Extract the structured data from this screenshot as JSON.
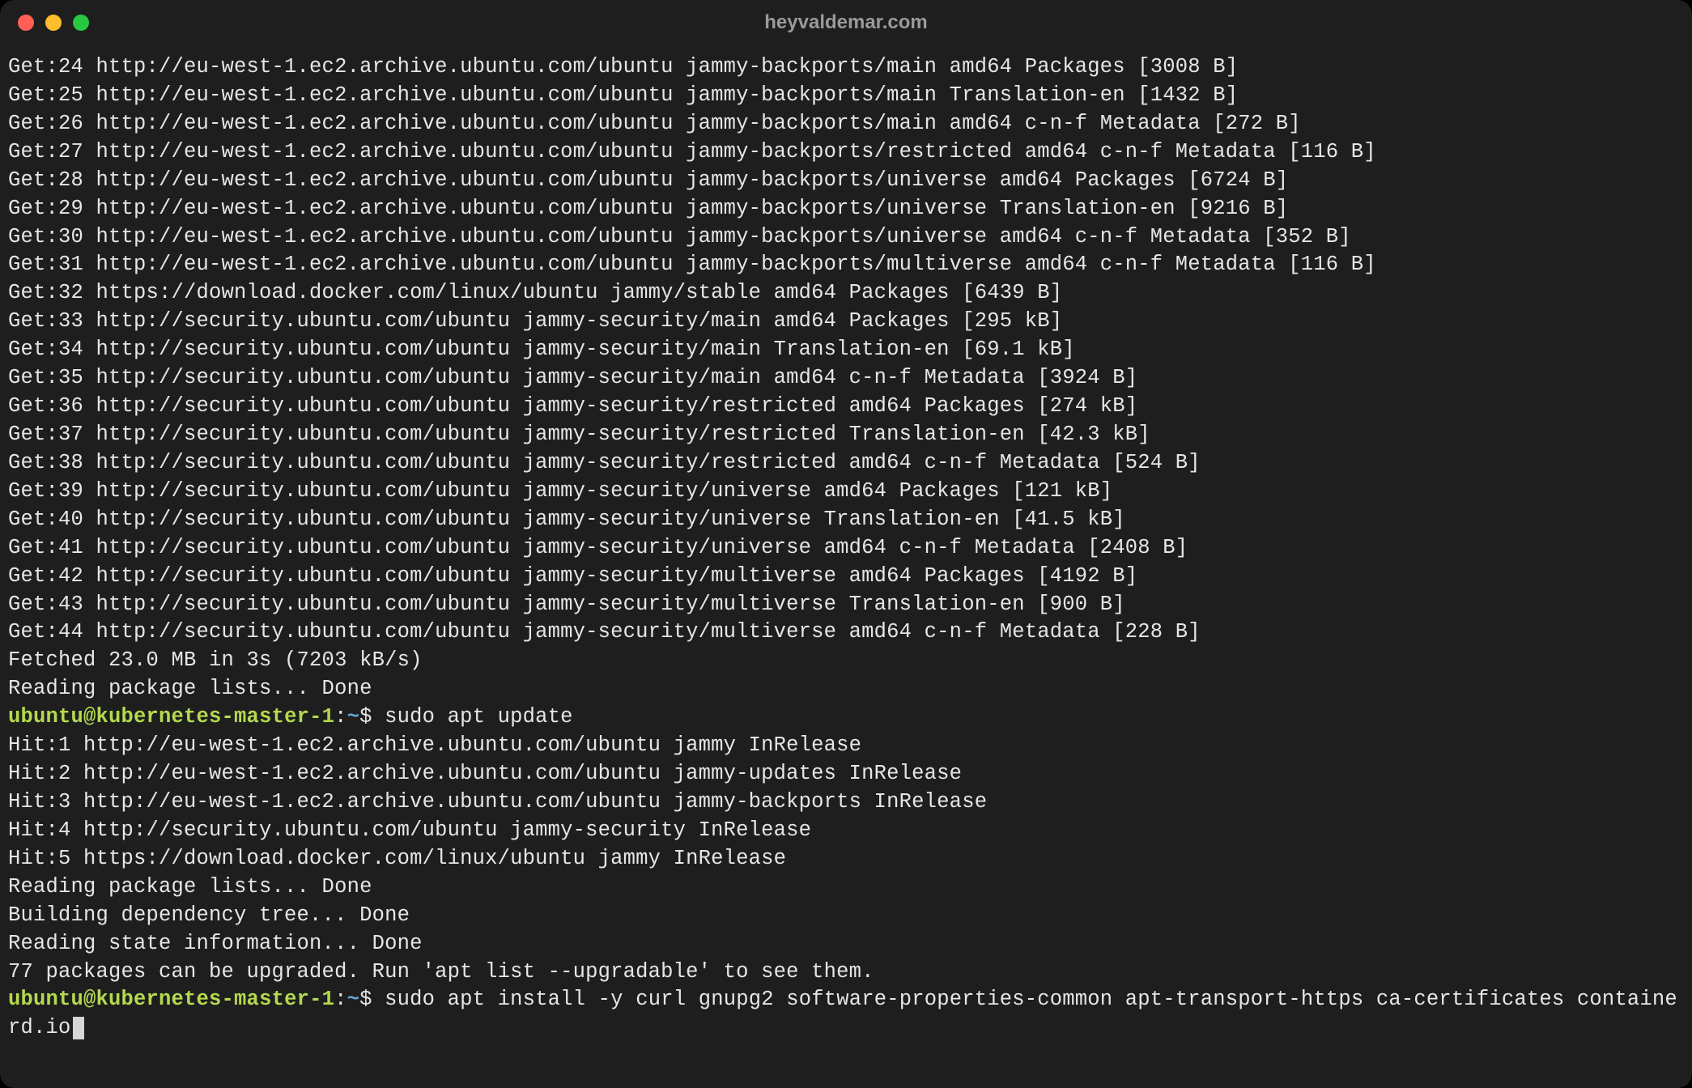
{
  "window": {
    "title": "heyvaldemar.com"
  },
  "prompt": {
    "user": "ubuntu",
    "at": "@",
    "host": "kubernetes-master-1",
    "colon": ":",
    "path": "~",
    "sigil": "$ "
  },
  "output_before": [
    "Get:24 http://eu-west-1.ec2.archive.ubuntu.com/ubuntu jammy-backports/main amd64 Packages [3008 B]",
    "Get:25 http://eu-west-1.ec2.archive.ubuntu.com/ubuntu jammy-backports/main Translation-en [1432 B]",
    "Get:26 http://eu-west-1.ec2.archive.ubuntu.com/ubuntu jammy-backports/main amd64 c-n-f Metadata [272 B]",
    "Get:27 http://eu-west-1.ec2.archive.ubuntu.com/ubuntu jammy-backports/restricted amd64 c-n-f Metadata [116 B]",
    "Get:28 http://eu-west-1.ec2.archive.ubuntu.com/ubuntu jammy-backports/universe amd64 Packages [6724 B]",
    "Get:29 http://eu-west-1.ec2.archive.ubuntu.com/ubuntu jammy-backports/universe Translation-en [9216 B]",
    "Get:30 http://eu-west-1.ec2.archive.ubuntu.com/ubuntu jammy-backports/universe amd64 c-n-f Metadata [352 B]",
    "Get:31 http://eu-west-1.ec2.archive.ubuntu.com/ubuntu jammy-backports/multiverse amd64 c-n-f Metadata [116 B]",
    "Get:32 https://download.docker.com/linux/ubuntu jammy/stable amd64 Packages [6439 B]",
    "Get:33 http://security.ubuntu.com/ubuntu jammy-security/main amd64 Packages [295 kB]",
    "Get:34 http://security.ubuntu.com/ubuntu jammy-security/main Translation-en [69.1 kB]",
    "Get:35 http://security.ubuntu.com/ubuntu jammy-security/main amd64 c-n-f Metadata [3924 B]",
    "Get:36 http://security.ubuntu.com/ubuntu jammy-security/restricted amd64 Packages [274 kB]",
    "Get:37 http://security.ubuntu.com/ubuntu jammy-security/restricted Translation-en [42.3 kB]",
    "Get:38 http://security.ubuntu.com/ubuntu jammy-security/restricted amd64 c-n-f Metadata [524 B]",
    "Get:39 http://security.ubuntu.com/ubuntu jammy-security/universe amd64 Packages [121 kB]",
    "Get:40 http://security.ubuntu.com/ubuntu jammy-security/universe Translation-en [41.5 kB]",
    "Get:41 http://security.ubuntu.com/ubuntu jammy-security/universe amd64 c-n-f Metadata [2408 B]",
    "Get:42 http://security.ubuntu.com/ubuntu jammy-security/multiverse amd64 Packages [4192 B]",
    "Get:43 http://security.ubuntu.com/ubuntu jammy-security/multiverse Translation-en [900 B]",
    "Get:44 http://security.ubuntu.com/ubuntu jammy-security/multiverse amd64 c-n-f Metadata [228 B]",
    "Fetched 23.0 MB in 3s (7203 kB/s)",
    "Reading package lists... Done"
  ],
  "command1": "sudo apt update",
  "output_after": [
    "Hit:1 http://eu-west-1.ec2.archive.ubuntu.com/ubuntu jammy InRelease",
    "Hit:2 http://eu-west-1.ec2.archive.ubuntu.com/ubuntu jammy-updates InRelease",
    "Hit:3 http://eu-west-1.ec2.archive.ubuntu.com/ubuntu jammy-backports InRelease",
    "Hit:4 http://security.ubuntu.com/ubuntu jammy-security InRelease",
    "Hit:5 https://download.docker.com/linux/ubuntu jammy InRelease",
    "Reading package lists... Done",
    "Building dependency tree... Done",
    "Reading state information... Done",
    "77 packages can be upgraded. Run 'apt list --upgradable' to see them."
  ],
  "command2": "sudo apt install -y curl gnupg2 software-properties-common apt-transport-https ca-certificates containerd.io"
}
